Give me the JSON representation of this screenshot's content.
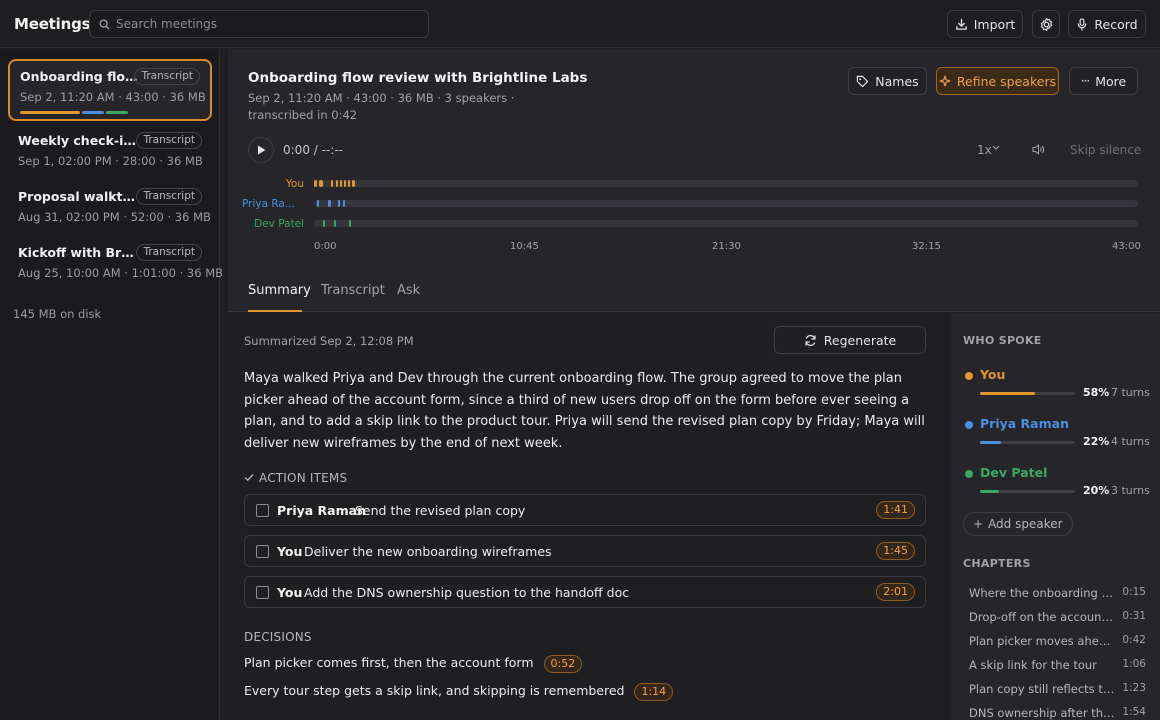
{
  "app": {
    "title": "Meetings"
  },
  "search": {
    "placeholder": "Search meetings",
    "value": ""
  },
  "toolbar": {
    "import_label": "Import",
    "settings_icon": "gear-icon",
    "record_label": "Record"
  },
  "sidebar": {
    "meetings": [
      {
        "title": "Onboarding flow review with Brightline Labs",
        "badge": "Transcript",
        "meta": "Sep 2, 11:20 AM · 43:00 · 36 MB",
        "active": true
      },
      {
        "title": "Weekly check-in with Priya",
        "badge": "Transcript",
        "meta": "Sep 1, 02:00 PM · 28:00 · 36 MB",
        "active": false
      },
      {
        "title": "Proposal walkthrough",
        "badge": "Transcript",
        "meta": "Aug 31, 02:00 PM · 52:00 · 36 MB",
        "active": false
      },
      {
        "title": "Kickoff with Brightline Labs",
        "badge": "Transcript",
        "meta": "Aug 25, 10:00 AM · 1:01:00 · 36 MB",
        "active": false
      }
    ],
    "disk_usage": "145 MB on disk"
  },
  "meeting": {
    "title": "Onboarding flow review with Brightline Labs",
    "meta": "Sep 2, 11:20 AM  ·  43:00  ·  36 MB  ·  3 speakers  ·",
    "meta2": "transcribed in 0:42",
    "buttons": {
      "names": "Names",
      "refine": "Refine speakers",
      "more": "More"
    }
  },
  "player": {
    "time": "0:00 / --:--",
    "speed": "1x",
    "skip_silence": "Skip silence",
    "speakers": [
      {
        "label": "You",
        "color": "#e0962f"
      },
      {
        "label": "Priya Ra...",
        "color": "#4a8fe0"
      },
      {
        "label": "Dev Patel",
        "color": "#3aa860"
      }
    ],
    "axis_ticks": [
      "0:00",
      "10:45",
      "21:30",
      "32:15",
      "43:00"
    ]
  },
  "tabs": [
    "Summary",
    "Transcript",
    "Ask"
  ],
  "summary": {
    "date": "Summarized Sep 2, 12:08 PM",
    "regenerate_label": "Regenerate",
    "text": "Maya walked Priya and Dev through the current onboarding flow. The group agreed to move the plan picker ahead of the account form, since a third of new users drop off on the form before ever seeing a plan, and to add a skip link to the product tour. Priya will send the revised plan copy by Friday; Maya will deliver new wireframes by the end of next week.",
    "action_items_heading": "ACTION ITEMS",
    "action_items": [
      {
        "owner": "Priya Raman",
        "task": "Send the revised plan copy",
        "time": "1:41"
      },
      {
        "owner": "You",
        "task": "Deliver the new onboarding wireframes",
        "time": "1:45"
      },
      {
        "owner": "You",
        "task": "Add the DNS ownership question to the handoff doc",
        "time": "2:01"
      }
    ],
    "decisions_heading": "DECISIONS",
    "decisions": [
      {
        "text": "Plan picker comes first, then the account form",
        "time": "0:52"
      },
      {
        "text": "Every tour step gets a skip link, and skipping is remembered",
        "time": "1:14"
      }
    ]
  },
  "who_spoke": {
    "heading": "WHO SPOKE",
    "speakers": [
      {
        "name": "You",
        "pct": "58%",
        "share": 0.58,
        "turns": "7 turns",
        "color": "#e0962f"
      },
      {
        "name": "Priya Raman",
        "pct": "22%",
        "share": 0.22,
        "turns": "4 turns",
        "color": "#4a8fe0"
      },
      {
        "name": "Dev Patel",
        "pct": "20%",
        "share": 0.2,
        "turns": "3 turns",
        "color": "#3aa860"
      }
    ],
    "add_speaker_label": "Add speaker"
  },
  "chapters": {
    "heading": "CHAPTERS",
    "items": [
      {
        "title": "Where the onboarding flow stands today",
        "time": "0:15"
      },
      {
        "title": "Drop-off on the account form",
        "time": "0:31"
      },
      {
        "title": "Plan picker moves ahead of the form",
        "time": "0:42"
      },
      {
        "title": "A skip link for the tour",
        "time": "1:06"
      },
      {
        "title": "Plan copy still reflects the old tiers",
        "time": "1:23"
      },
      {
        "title": "DNS ownership after the handoff",
        "time": "1:54"
      }
    ]
  }
}
